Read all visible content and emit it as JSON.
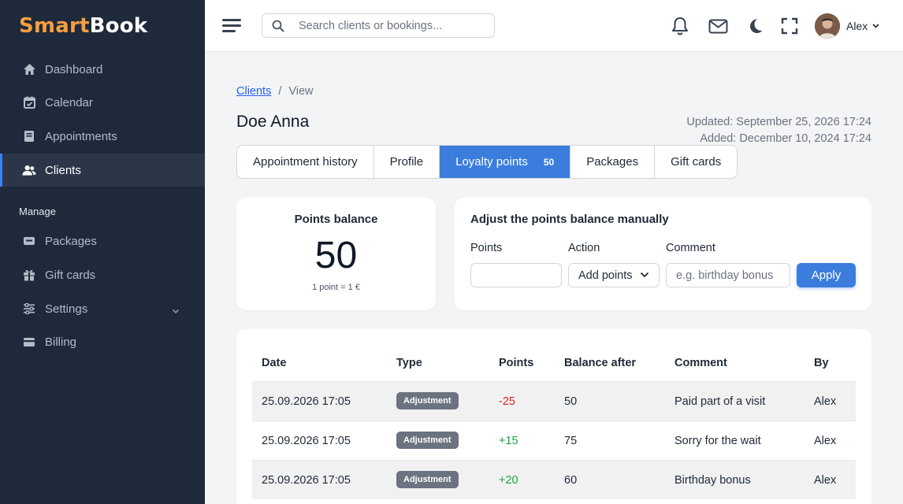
{
  "brand": {
    "part1": "Smart",
    "part2": "Book"
  },
  "sidebar": {
    "items": [
      {
        "label": "Dashboard",
        "icon": "home-icon"
      },
      {
        "label": "Calendar",
        "icon": "calendar-icon"
      },
      {
        "label": "Appointments",
        "icon": "book-icon"
      },
      {
        "label": "Clients",
        "icon": "users-icon",
        "active": true
      }
    ],
    "section_label": "Manage",
    "manage_items": [
      {
        "label": "Packages",
        "icon": "package-icon"
      },
      {
        "label": "Gift cards",
        "icon": "gift-icon"
      },
      {
        "label": "Settings",
        "icon": "sliders-icon"
      },
      {
        "label": "Billing",
        "icon": "credit-card-icon"
      }
    ]
  },
  "header": {
    "search_placeholder": "Search clients or bookings...",
    "user_name": "Alex"
  },
  "breadcrumb": {
    "link": "Clients",
    "separator": "/",
    "current": "View"
  },
  "client": {
    "name": "Doe Anna",
    "updated": "Updated: September 25, 2026 17:24",
    "added": "Added: December 10, 2024 17:24"
  },
  "tabs": [
    {
      "label": "Appointment history"
    },
    {
      "label": "Profile"
    },
    {
      "label": "Loyalty points",
      "badge": "50",
      "active": true
    },
    {
      "label": "Packages"
    },
    {
      "label": "Gift cards"
    }
  ],
  "balance": {
    "label": "Points balance",
    "value": "50",
    "rate": "1 point = 1 €"
  },
  "adjust": {
    "title": "Adjust the points balance manually",
    "points_label": "Points",
    "points_value": "",
    "action_label": "Action",
    "action_value": "Add points",
    "comment_label": "Comment",
    "comment_placeholder": "e.g. birthday bonus",
    "apply_label": "Apply"
  },
  "table": {
    "headers": [
      "Date",
      "Type",
      "Points",
      "Balance after",
      "Comment",
      "By"
    ],
    "rows": [
      {
        "date": "25.09.2026 17:05",
        "type": "Adjustment",
        "points": "-25",
        "balance": "50",
        "comment": "Paid part of a visit",
        "by": "Alex"
      },
      {
        "date": "25.09.2026 17:05",
        "type": "Adjustment",
        "points": "+15",
        "balance": "75",
        "comment": "Sorry for the wait",
        "by": "Alex"
      },
      {
        "date": "25.09.2026 17:05",
        "type": "Adjustment",
        "points": "+20",
        "balance": "60",
        "comment": "Birthday bonus",
        "by": "Alex"
      }
    ]
  },
  "colors": {
    "accent": "#3b7ddd",
    "sidebar": "#1e293b",
    "brand_orange": "#f59e42",
    "negative": "#dc2626",
    "positive": "#16a34a"
  }
}
